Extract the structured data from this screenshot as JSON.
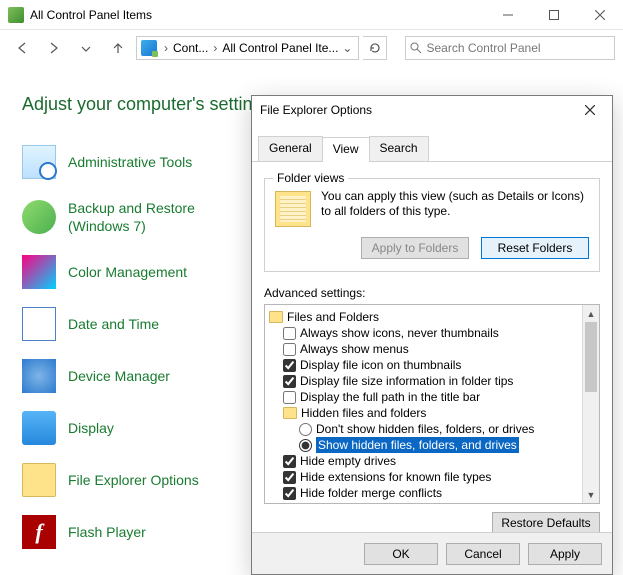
{
  "window": {
    "title": "All Control Panel Items",
    "breadcrumb1": "Cont...",
    "breadcrumb2": "All Control Panel Ite...",
    "search_placeholder": "Search Control Panel"
  },
  "main": {
    "heading": "Adjust your computer's settings",
    "items": [
      {
        "label": "Administrative Tools"
      },
      {
        "label": "Backup and Restore (Windows 7)"
      },
      {
        "label": "Color Management"
      },
      {
        "label": "Date and Time"
      },
      {
        "label": "Device Manager"
      },
      {
        "label": "Display"
      },
      {
        "label": "File Explorer Options"
      },
      {
        "label": "Flash Player"
      }
    ]
  },
  "dialog": {
    "title": "File Explorer Options",
    "tabs": [
      "General",
      "View",
      "Search"
    ],
    "folderviews": {
      "legend": "Folder views",
      "text": "You can apply this view (such as Details or Icons) to all folders of this type.",
      "apply_btn": "Apply to Folders",
      "reset_btn": "Reset Folders"
    },
    "advanced_label": "Advanced settings:",
    "tree": {
      "root": "Files and Folders",
      "n1": "Always show icons, never thumbnails",
      "n2": "Always show menus",
      "n3": "Display file icon on thumbnails",
      "n4": "Display file size information in folder tips",
      "n5": "Display the full path in the title bar",
      "hf": "Hidden files and folders",
      "r1": "Don't show hidden files, folders, or drives",
      "r2": "Show hidden files, folders, and drives",
      "n6": "Hide empty drives",
      "n7": "Hide extensions for known file types",
      "n8": "Hide folder merge conflicts"
    },
    "restore_defaults": "Restore Defaults",
    "ok": "OK",
    "cancel": "Cancel",
    "apply": "Apply"
  }
}
